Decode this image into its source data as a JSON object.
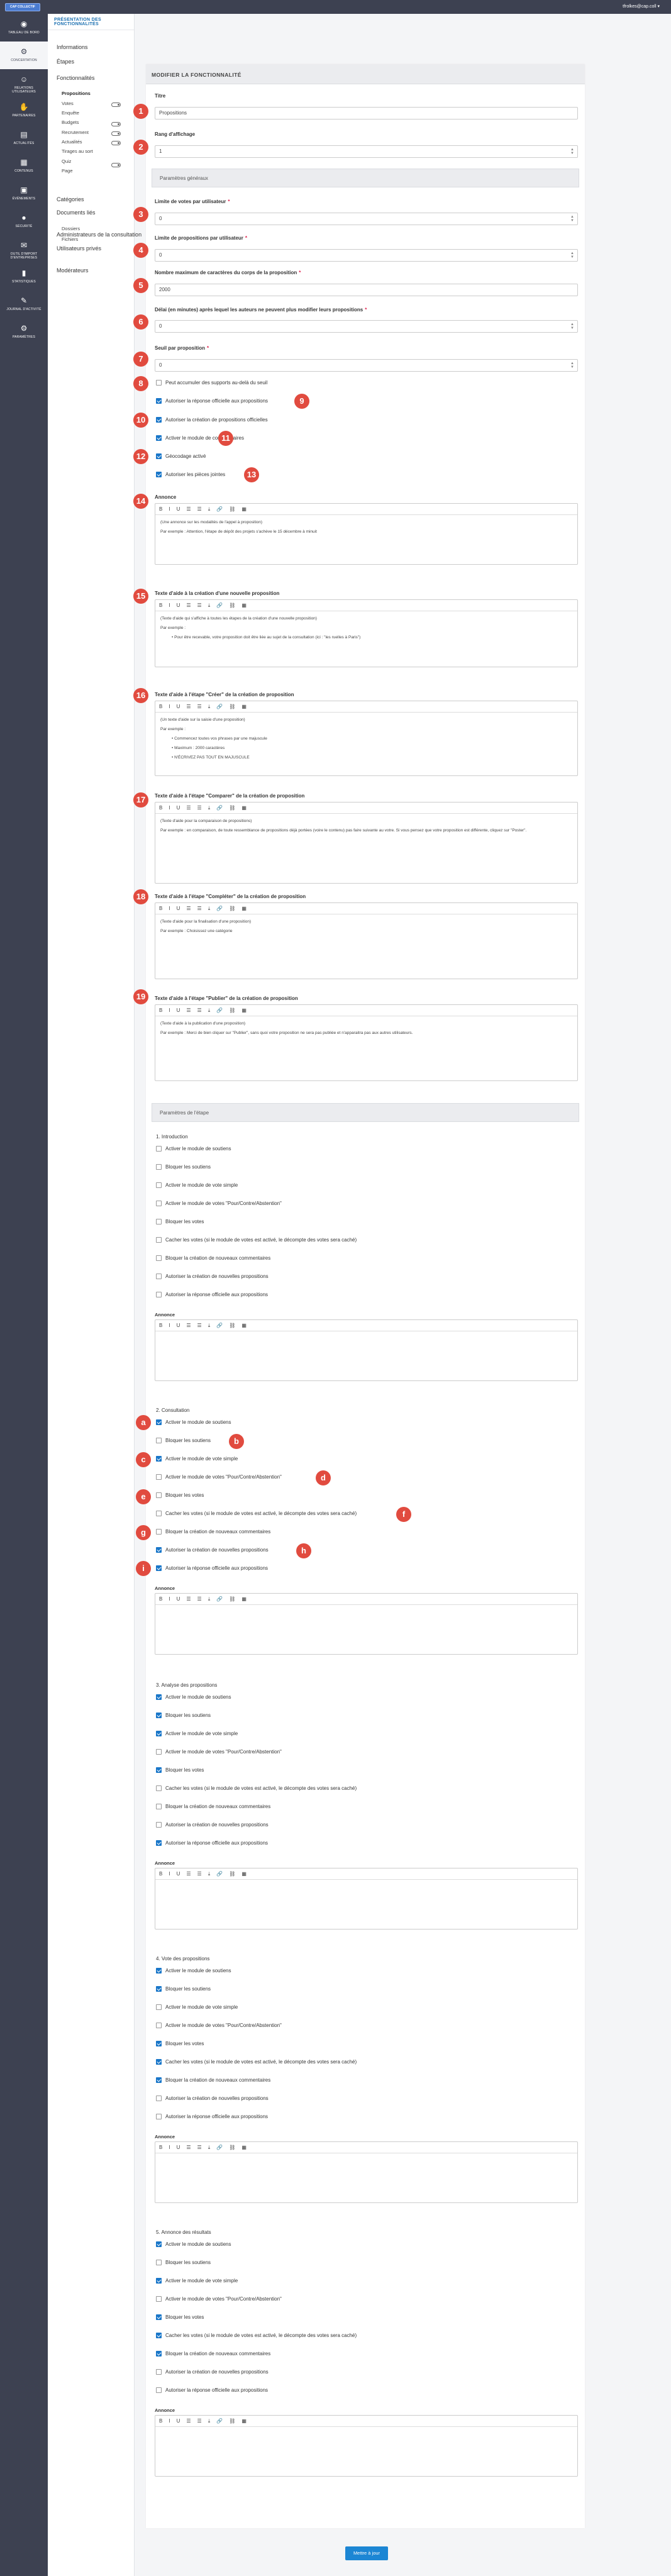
{
  "topbar": {
    "logo": "CAP COLLECTIF",
    "user": "tfrolkes@cap.coll ▾"
  },
  "sidebar": [
    {
      "label": "Tableau de bord",
      "icon": "dashboard-icon"
    },
    {
      "label": "Concertation",
      "icon": "gear-icon",
      "active": true
    },
    {
      "label": "Relations utilisateurs",
      "icon": "users-icon"
    },
    {
      "label": "Partenaires",
      "icon": "handshake-icon"
    },
    {
      "label": "Actualités",
      "icon": "news-icon"
    },
    {
      "label": "Contenus",
      "icon": "content-icon"
    },
    {
      "label": "Événements",
      "icon": "calendar-icon"
    },
    {
      "label": "Sécurité",
      "icon": "lock-icon"
    },
    {
      "label": "Outil d'import d'entreprises",
      "icon": "mail-icon"
    },
    {
      "label": "Statistiques",
      "icon": "stats-icon"
    },
    {
      "label": "Journal d'activité",
      "icon": "journal-icon"
    },
    {
      "label": "Paramètres",
      "icon": "settings-icon"
    }
  ],
  "subnav": {
    "title": "Présentation des fonctionnalités",
    "items": [
      "Informations",
      "Étapes",
      "Fonctionnalités",
      "Catégories",
      "Documents liés",
      "Administrateurs de la consultation",
      "Utilisateurs privés",
      "Modérateurs"
    ],
    "children": [
      "Propositions",
      "Votes",
      "Enquête",
      "Budgets",
      "Recrutement",
      "Actualités",
      "Tirages au sort",
      "Quiz",
      "Page"
    ],
    "docs": [
      "Dossiers",
      "Fichiers"
    ]
  },
  "panel": {
    "title": "Modifier la fonctionnalité",
    "general": "Paramètres généraux",
    "step_params": "Paramètres de l'étape",
    "save": "Mettre à jour"
  },
  "fields": [
    {
      "label": "Titre",
      "value": "Propositions",
      "req": false,
      "spin": false
    },
    {
      "label": "Rang d'affichage",
      "value": "1",
      "req": false,
      "spin": true
    },
    {
      "label": "Limite de votes par utilisateur",
      "value": "0",
      "req": true,
      "spin": true
    },
    {
      "label": "Limite de propositions par utilisateur",
      "value": "0",
      "req": true,
      "spin": true
    },
    {
      "label": "Nombre maximum de caractères du corps de la proposition",
      "value": "2000",
      "req": true,
      "spin": false
    },
    {
      "label": "Délai (en minutes) après lequel les auteurs ne peuvent plus modifier leurs propositions",
      "value": "0",
      "req": true,
      "spin": true
    },
    {
      "label": "Seuil par proposition",
      "value": "0",
      "req": true,
      "spin": true
    }
  ],
  "general_checks": [
    {
      "label": "Peut accumuler des supports au-delà du seuil",
      "on": false
    },
    {
      "label": "Autoriser la réponse officielle aux propositions",
      "on": true
    },
    {
      "label": "Autoriser la création de propositions officielles",
      "on": true
    },
    {
      "label": "Activer le module de commentaires",
      "on": true
    },
    {
      "label": "Géocodage activé",
      "on": true
    },
    {
      "label": "Autoriser les pièces jointes",
      "on": true
    }
  ],
  "toolbar": [
    "B",
    "I",
    "U",
    "☰",
    "☰",
    "⤓",
    "🔗",
    "⛓",
    "▦"
  ],
  "editors": [
    {
      "label": "Annonce",
      "lines": [
        "(Une annonce sur les modalités de l'appel à proposition)",
        "Par exemple : Attention, l'étape de dépôt des projets s'achève le 15 décembre à minuit"
      ]
    },
    {
      "label": "Texte d'aide à la création d'une nouvelle proposition",
      "lines": [
        "(Texte d'aide qui s'affiche à toutes les étapes de la création d'une nouvelle proposition)",
        "Par exemple :",
        "• Pour être recevable, votre proposition doit être liée au sujet de la consultation (ici : \"les ruelles à Paris\")"
      ]
    },
    {
      "label": "Texte d'aide à l'étape \"Créer\" de la création de proposition",
      "lines": [
        "(Un texte d'aide sur la saisie d'une proposition)",
        "Par exemple :",
        "• Commencez toutes vos phrases par une majuscule",
        "• Maximum : 2000 caractères",
        "• N'ÉCRIVEZ PAS TOUT EN MAJUSCULE"
      ]
    },
    {
      "label": "Texte d'aide à l'étape \"Comparer\" de la création de proposition",
      "lines": [
        "(Texte d'aide pour la comparaison de propositions)",
        "Par exemple : en comparaison, de toute ressemblance de propositions déjà portées (voire le contenu) pas faire suivante au votre. Si vous pensez que votre proposition est différente, cliquez sur \"Poster\"."
      ]
    },
    {
      "label": "Texte d'aide à l'étape \"Compléter\" de la création de proposition",
      "lines": [
        "(Texte d'aide pour la finalisation d'une proposition)",
        "Par exemple : Choisissez une catégorie"
      ]
    },
    {
      "label": "Texte d'aide à l'étape \"Publier\" de la création de proposition",
      "lines": [
        "(Texte d'aide à la publication d'une proposition)",
        "Par exemple : Merci de bien cliquer sur \"Publier\", sans quoi votre proposition ne sera pas publiée et n'apparaitra pas aux autres utilisateurs."
      ]
    }
  ],
  "step_checks_labels": [
    "Activer le module de soutiens",
    "Bloquer les soutiens",
    "Activer le module de vote simple",
    "Activer le module de votes \"Pour/Contre/Abstention\"",
    "Bloquer les votes",
    "Cacher les votes (si le module de votes est activé, le décompte des votes sera caché)",
    "Bloquer la création de nouveaux commentaires",
    "Autoriser la création de nouvelles propositions",
    "Autoriser la réponse officielle aux propositions"
  ],
  "steps": [
    {
      "title": "1. Introduction",
      "on": [
        false,
        false,
        false,
        false,
        false,
        false,
        false,
        false,
        false
      ],
      "annonce": "Annonce"
    },
    {
      "title": "2. Consultation",
      "on": [
        true,
        false,
        true,
        false,
        false,
        false,
        false,
        true,
        true
      ],
      "annonce": "Annonce"
    },
    {
      "title": "3. Analyse des propositions",
      "on": [
        true,
        true,
        true,
        false,
        true,
        false,
        false,
        false,
        true
      ],
      "annonce": "Annonce"
    },
    {
      "title": "4. Vote des propositions",
      "on": [
        true,
        true,
        false,
        false,
        true,
        true,
        true,
        false,
        false
      ],
      "annonce": "Annonce"
    },
    {
      "title": "5. Annonce des résultats",
      "on": [
        true,
        false,
        true,
        false,
        true,
        true,
        true,
        false,
        false
      ],
      "annonce": "Annonce"
    }
  ],
  "badges_num": [
    "1",
    "2",
    "3",
    "4",
    "5",
    "6",
    "7",
    "8",
    "9",
    "10",
    "11",
    "12",
    "13",
    "14",
    "15",
    "16",
    "17",
    "18",
    "19"
  ],
  "badges_alpha": [
    "a",
    "b",
    "c",
    "d",
    "e",
    "f",
    "g",
    "h",
    "i"
  ],
  "colors": {
    "sidebar": "#3d4151",
    "accent": "#1c86d4",
    "badge": "#e14b3f",
    "checkbox": "#1a77c9"
  }
}
